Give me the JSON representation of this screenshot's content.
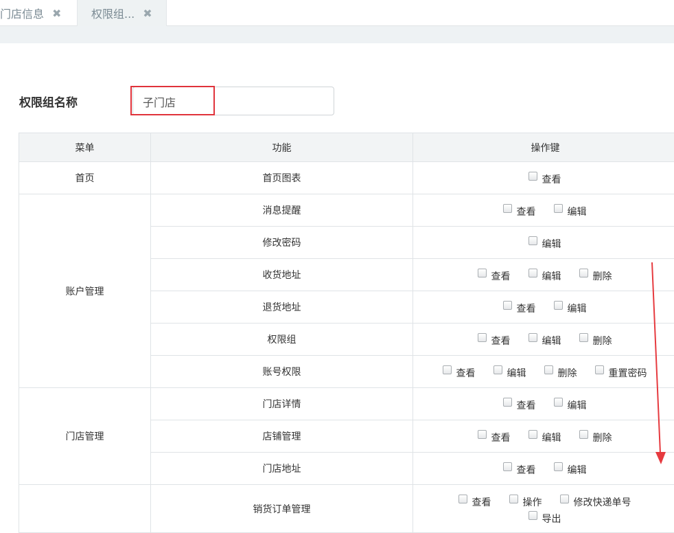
{
  "tabs": [
    {
      "label": "门店信息",
      "close": "✖"
    },
    {
      "label": "权限组...",
      "close": "✖"
    }
  ],
  "form": {
    "name_label": "权限组名称",
    "name_value": "子门店"
  },
  "table": {
    "headers": [
      "菜单",
      "功能",
      "操作键"
    ],
    "groups": [
      {
        "menu": "首页",
        "rows": [
          {
            "func": "首页图表",
            "ops": [
              "查看"
            ]
          }
        ]
      },
      {
        "menu": "账户管理",
        "rows": [
          {
            "func": "消息提醒",
            "ops": [
              "查看",
              "编辑"
            ]
          },
          {
            "func": "修改密码",
            "ops": [
              "编辑"
            ]
          },
          {
            "func": "收货地址",
            "ops": [
              "查看",
              "编辑",
              "删除"
            ]
          },
          {
            "func": "退货地址",
            "ops": [
              "查看",
              "编辑"
            ]
          },
          {
            "func": "权限组",
            "ops": [
              "查看",
              "编辑",
              "删除"
            ]
          },
          {
            "func": "账号权限",
            "ops": [
              "查看",
              "编辑",
              "删除",
              "重置密码"
            ]
          }
        ]
      },
      {
        "menu": "门店管理",
        "rows": [
          {
            "func": "门店详情",
            "ops": [
              "查看",
              "编辑"
            ]
          },
          {
            "func": "店铺管理",
            "ops": [
              "查看",
              "编辑",
              "删除"
            ]
          },
          {
            "func": "门店地址",
            "ops": [
              "查看",
              "编辑"
            ]
          }
        ]
      },
      {
        "menu": "",
        "rows": [
          {
            "func": "销货订单管理",
            "ops": [
              "查看",
              "操作",
              "修改快递单号",
              "导出"
            ]
          }
        ]
      }
    ]
  },
  "annotation": {
    "arrow_color": "#e63a3f",
    "highlight_color": "#e0323a"
  }
}
